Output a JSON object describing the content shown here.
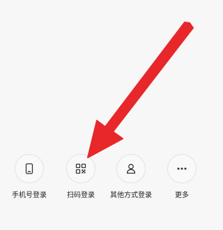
{
  "login_options": [
    {
      "label": "手机号登录",
      "icon": "phone-icon"
    },
    {
      "label": "扫码登录",
      "icon": "qr-code-icon"
    },
    {
      "label": "其他方式登录",
      "icon": "person-icon"
    },
    {
      "label": "更多",
      "icon": "more-dots-icon"
    }
  ],
  "annotation": {
    "arrow_color": "#e8272b",
    "points_to": "扫码登录"
  },
  "colors": {
    "background": "#f7f7f7",
    "icon_stroke": "#333333",
    "circle_border": "#e2e2e2"
  }
}
